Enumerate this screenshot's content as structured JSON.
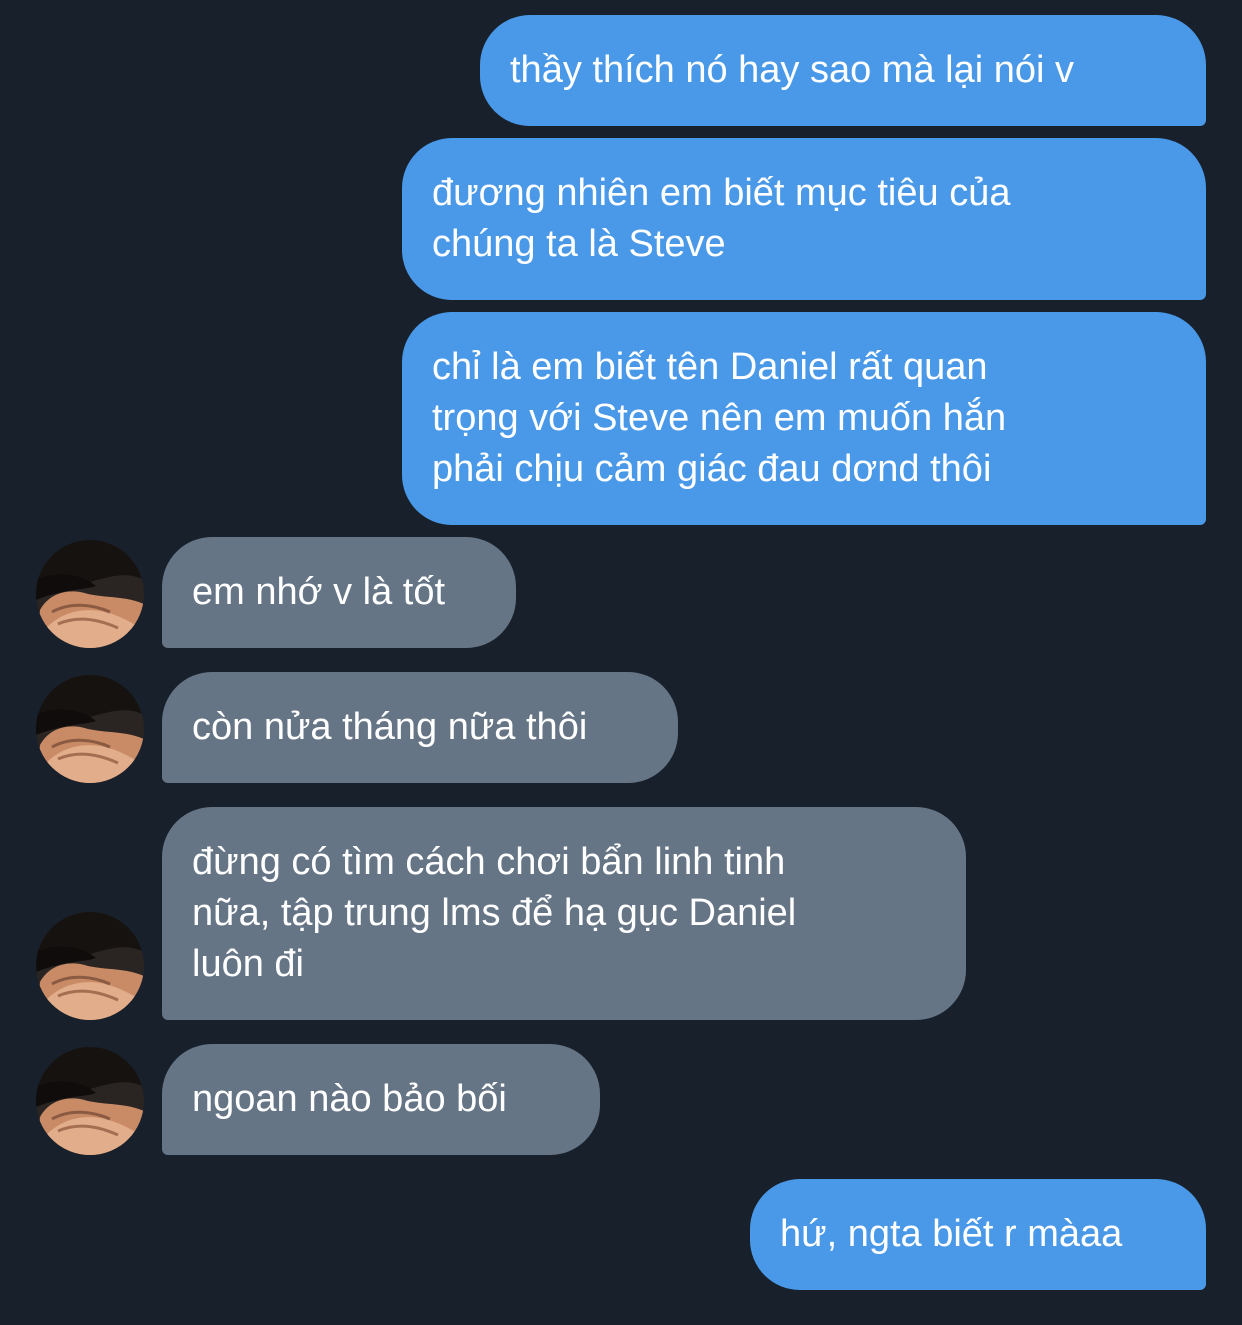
{
  "messages": [
    {
      "sender": "me",
      "lines": [
        "thầy thích nó hay sao mà lại nói v"
      ]
    },
    {
      "sender": "me",
      "lines": [
        "đương nhiên em biết mục tiêu của",
        "chúng ta là Steve"
      ]
    },
    {
      "sender": "me",
      "lines": [
        "chỉ là em biết tên Daniel rất quan",
        "trọng với Steve nên em muốn hắn",
        "phải chịu cảm giác đau dơnd thôi"
      ]
    },
    {
      "sender": "other",
      "lines": [
        "em nhớ v là tốt"
      ]
    },
    {
      "sender": "other",
      "lines": [
        "còn nửa tháng nữa thôi"
      ]
    },
    {
      "sender": "other",
      "lines": [
        "đừng có tìm cách chơi bẩn linh tinh",
        "nữa, tập trung lms để hạ gục Daniel",
        "luôn đi"
      ]
    },
    {
      "sender": "other",
      "lines": [
        "ngoan nào bảo bối"
      ]
    },
    {
      "sender": "me",
      "lines": [
        "hứ, ngta biết r màaa"
      ]
    }
  ],
  "colors": {
    "background": "#18202b",
    "outgoing_bubble": "#4a99e8",
    "incoming_bubble": "#667585",
    "text": "#ffffff"
  },
  "icons": {
    "avatar": "avatar-photo-icon"
  }
}
